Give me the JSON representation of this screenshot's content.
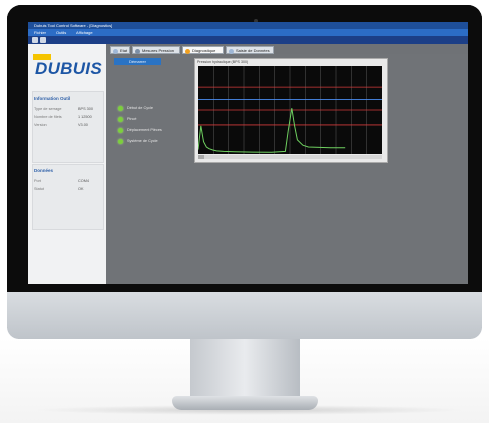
{
  "window": {
    "title": "Dubuis Tool Control Software - [Diagnostics]"
  },
  "menu": {
    "items": [
      "Fichier",
      "Outils",
      "Affichage"
    ]
  },
  "sidebar": {
    "logo_text": "DUBUIS",
    "panel1": {
      "heading": "Information Outil",
      "rows": [
        {
          "label": "Type de serrage",
          "value": "BPS 300"
        },
        {
          "label": "Nombre de filets",
          "value": "1 12500"
        },
        {
          "label": "Version",
          "value": "V3.00"
        }
      ]
    },
    "panel2": {
      "heading": "Données",
      "rows": [
        {
          "label": "Port",
          "value": "COM4"
        },
        {
          "label": "Statut",
          "value": "OK"
        }
      ]
    }
  },
  "tabs": [
    {
      "label": "Etat",
      "icon": "info-icon",
      "color": "#9fb7d6"
    },
    {
      "label": "Mesures Pression",
      "icon": "wrench-icon",
      "color": "#7c8fa6"
    },
    {
      "label": "Diagnostique",
      "icon": "warning-icon",
      "color": "#f0a020"
    },
    {
      "label": "Saisie de Données",
      "icon": "database-icon",
      "color": "#9fb7d6"
    }
  ],
  "content": {
    "button_label": "Démarrer",
    "status_items": [
      "Début de Cycle",
      "Pincé",
      "Déplacement Pièces",
      "Système de Cycle"
    ],
    "status_color": "#7ccf3c"
  },
  "chart_data": {
    "type": "line",
    "title": "Pression hydraulique (BPS 300)",
    "xlim": [
      0,
      100
    ],
    "ylim": [
      0,
      10
    ],
    "grid": true,
    "series": [
      {
        "color": "#6fd060",
        "x": [
          0,
          1.5,
          3,
          4.5,
          6,
          8,
          10,
          14,
          20,
          30,
          40,
          47.5,
          49,
          51,
          52.5,
          54,
          57,
          60,
          66,
          72,
          78,
          80
        ],
        "y": [
          0.5,
          3.2,
          1.4,
          0.8,
          0.6,
          0.45,
          0.35,
          0.3,
          0.25,
          0.22,
          0.2,
          0.3,
          2.6,
          5.2,
          3.2,
          1.6,
          1.0,
          0.8,
          0.75,
          0.7,
          0.7,
          0.7
        ]
      }
    ],
    "reference_lines": [
      {
        "y": 7.6,
        "color": "#d23a3a"
      },
      {
        "y": 6.2,
        "color": "#4b8cf0"
      },
      {
        "y": 5.0,
        "color": "#d23a3a"
      },
      {
        "y": 3.3,
        "color": "#d23a3a"
      }
    ]
  }
}
